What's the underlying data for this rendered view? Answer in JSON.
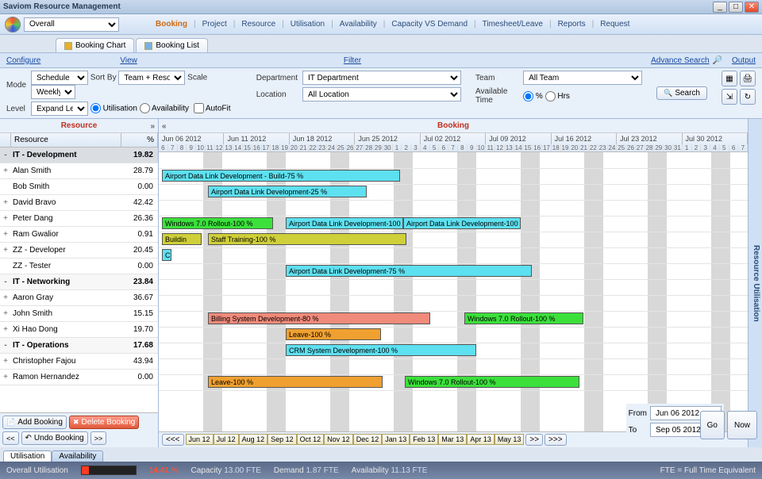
{
  "window": {
    "title": "Saviom Resource Management"
  },
  "toolbar": {
    "dropdown": "Overall",
    "nav": [
      "Booking",
      "Project",
      "Resource",
      "Utilisation",
      "Availability",
      "Capacity VS Demand",
      "Timesheet/Leave",
      "Reports",
      "Request"
    ],
    "nav_active": 0
  },
  "tabs": {
    "chart": "Booking Chart",
    "list": "Booking List"
  },
  "config": {
    "configure": "Configure",
    "view": "View",
    "filter": "Filter",
    "advsearch": "Advance Search",
    "output": "Output",
    "mode_l": "Mode",
    "mode": "Schedule",
    "sortby_l": "Sort By",
    "sortby": "Team + Resource",
    "scale_l": "Scale",
    "scale": "Weekly",
    "level_l": "Level",
    "level": "Expand Level",
    "util": "Utilisation",
    "avail": "Availability",
    "autofit": "AutoFit",
    "dept_l": "Department",
    "dept": "IT Department",
    "loc_l": "Location",
    "loc": "All Location",
    "team_l": "Team",
    "team": "All Team",
    "avt_l": "Available Time",
    "pct": "%",
    "hrs": "Hrs",
    "search": "Search"
  },
  "panes": {
    "resource": "Resource",
    "booking": "Booking",
    "sidetab": "Resource Utilisation"
  },
  "reshead": {
    "c1": "Resource",
    "c2": "%"
  },
  "resources": [
    {
      "name": "IT - Development",
      "pct": "19.82",
      "group": true,
      "sel": true
    },
    {
      "name": "Alan Smith",
      "pct": "28.79",
      "exp": true
    },
    {
      "name": "Bob Smith",
      "pct": "0.00"
    },
    {
      "name": "David Bravo",
      "pct": "42.42",
      "exp": true
    },
    {
      "name": "Peter Dang",
      "pct": "26.36",
      "exp": true
    },
    {
      "name": "Ram Gwalior",
      "pct": "0.91",
      "exp": true
    },
    {
      "name": "ZZ - Developer",
      "pct": "20.45",
      "exp": true
    },
    {
      "name": "ZZ - Tester",
      "pct": "0.00"
    },
    {
      "name": "IT - Networking",
      "pct": "23.84",
      "group": true
    },
    {
      "name": "Aaron Gray",
      "pct": "36.67",
      "exp": true
    },
    {
      "name": "John Smith",
      "pct": "15.15",
      "exp": true
    },
    {
      "name": "Xi Hao Dong",
      "pct": "19.70",
      "exp": true
    },
    {
      "name": "IT - Operations",
      "pct": "17.68",
      "group": true
    },
    {
      "name": "Christopher Fajou",
      "pct": "43.94",
      "exp": true
    },
    {
      "name": "Ramon Hernandez",
      "pct": "0.00",
      "exp": true
    }
  ],
  "leftbtns": {
    "add": "Add Booking",
    "del": "Delete Booking",
    "undo": "Undo Booking",
    "ll": "<<",
    "rr": ">>"
  },
  "weeks": [
    "Jun 06 2012",
    "Jun 11 2012",
    "Jun 18 2012",
    "Jun 25 2012",
    "Jul 02 2012",
    "Jul 09 2012",
    "Jul 16 2012",
    "Jul 23 2012",
    "Jul 30 2012"
  ],
  "days": [
    "6",
    "7",
    "8",
    "9",
    "10",
    "11",
    "12",
    "13",
    "14",
    "15",
    "16",
    "17",
    "18",
    "19",
    "20",
    "21",
    "22",
    "23",
    "24",
    "25",
    "26",
    "27",
    "28",
    "29",
    "30",
    "1",
    "2",
    "3",
    "4",
    "5",
    "6",
    "7",
    "8",
    "9",
    "10",
    "11",
    "12",
    "13",
    "14",
    "15",
    "16",
    "17",
    "18",
    "19",
    "20",
    "21",
    "22",
    "23",
    "24",
    "25",
    "26",
    "27",
    "28",
    "29",
    "30",
    "31",
    "1",
    "2",
    "3",
    "4",
    "5",
    "6",
    "7"
  ],
  "bars": [
    {
      "row": 1,
      "start": 4,
      "span": 300,
      "cls": "c-cyan",
      "label": "Airport Data Link Development - Build-75 %"
    },
    {
      "row": 2,
      "start": 62,
      "span": 200,
      "cls": "c-cyan",
      "label": "Airport Data Link Development-25 %"
    },
    {
      "row": 4,
      "start": 4,
      "span": 140,
      "cls": "c-green",
      "label": "Windows 7.0  Rollout-100 %"
    },
    {
      "row": 4,
      "start": 160,
      "span": 148,
      "cls": "c-cyan",
      "label": "Airport Data Link Development-100"
    },
    {
      "row": 4,
      "start": 308,
      "span": 148,
      "cls": "c-cyan",
      "label": "Airport Data Link Development-100"
    },
    {
      "row": 5,
      "start": 4,
      "span": 50,
      "cls": "c-olive",
      "label": "Buildin"
    },
    {
      "row": 5,
      "start": 62,
      "span": 250,
      "cls": "c-olive",
      "label": "Staff Training-100 %"
    },
    {
      "row": 6,
      "start": 4,
      "span": 12,
      "cls": "c-cyan",
      "label": "C"
    },
    {
      "row": 7,
      "start": 160,
      "span": 310,
      "cls": "c-cyan",
      "label": "Airport Data Link Development-75 %"
    },
    {
      "row": 10,
      "start": 62,
      "span": 280,
      "cls": "c-salmon",
      "label": "Billing System Development-80 %"
    },
    {
      "row": 10,
      "start": 385,
      "span": 150,
      "cls": "c-green",
      "label": "Windows 7.0  Rollout-100 %"
    },
    {
      "row": 11,
      "start": 160,
      "span": 120,
      "cls": "c-orange",
      "label": "Leave-100 %"
    },
    {
      "row": 12,
      "start": 160,
      "span": 240,
      "cls": "c-cyan",
      "label": "CRM System Development-100 %"
    },
    {
      "row": 14,
      "start": 62,
      "span": 220,
      "cls": "c-orange",
      "label": "Leave-100 %"
    },
    {
      "row": 14,
      "start": 310,
      "span": 220,
      "cls": "c-green",
      "label": "Windows 7.0  Rollout-100 %"
    }
  ],
  "months": {
    "nav_ll": "<<<",
    "nav_l": "<<",
    "nav_r": ">>",
    "nav_rr": ">>>",
    "items": [
      "Jun 12",
      "Jul 12",
      "Aug 12",
      "Sep 12",
      "Oct 12",
      "Nov 12",
      "Dec 12",
      "Jan 13",
      "Feb 13",
      "Mar 13",
      "Apr 13",
      "May 13"
    ]
  },
  "range": {
    "from_l": "From",
    "from": "Jun 06 2012",
    "to_l": "To",
    "to": "Sep 05 2012",
    "go": "Go",
    "now": "Now"
  },
  "bottomtabs": {
    "util": "Utilisation",
    "avail": "Availability"
  },
  "status": {
    "ou": "Overall Utilisation",
    "ou_v": "14.41 %",
    "cap": "Capacity",
    "cap_v": "13.00 FTE",
    "dem": "Demand",
    "dem_v": "1.87 FTE",
    "av": "Availability",
    "av_v": "11.13 FTE",
    "fte": "FTE = Full Time Equivalent"
  }
}
